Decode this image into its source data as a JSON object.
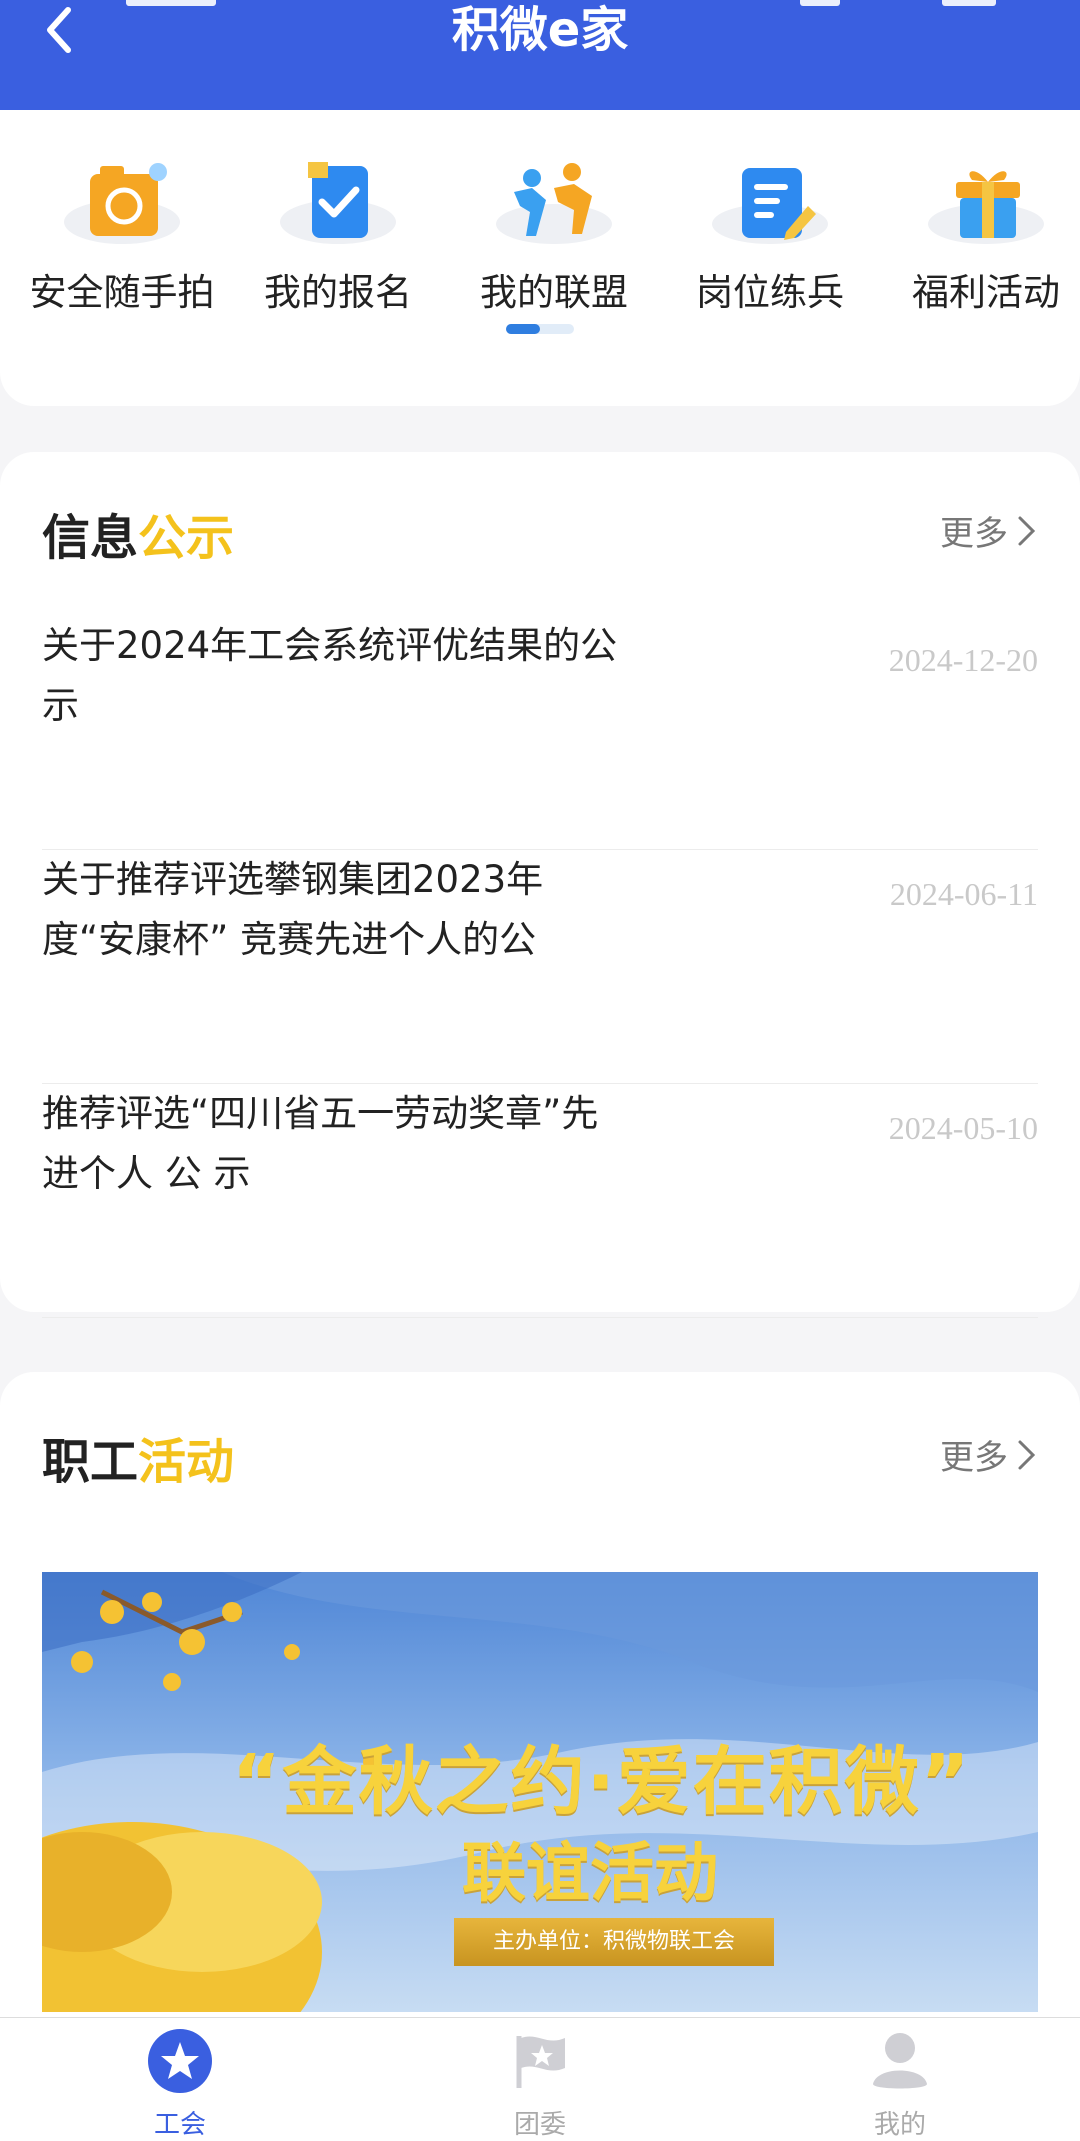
{
  "header": {
    "title": "积微e家"
  },
  "shortcuts": [
    {
      "label": "安全随手拍",
      "icon": "camera-icon",
      "color": "#f5a623"
    },
    {
      "label": "我的报名",
      "icon": "checkbox-icon",
      "color": "#2e8af0"
    },
    {
      "label": "我的联盟",
      "icon": "people-icon",
      "color": "#3aa0f0"
    },
    {
      "label": "岗位练兵",
      "icon": "document-icon",
      "color": "#2e8af0"
    },
    {
      "label": "福利活动",
      "icon": "gift-icon",
      "color": "#3aa0f0"
    }
  ],
  "info": {
    "title_a": "信息",
    "title_b": "公示",
    "more": "更多",
    "items": [
      {
        "text": "关于2024年工会系统评优结果的公示",
        "date": "2024-12-20"
      },
      {
        "text": "关于推荐评选攀钢集团2023年度“安康杯” 竞赛先进个人的公",
        "date": "2024-06-11"
      },
      {
        "text": "推荐评选“四川省五一劳动奖章”先进个人 公 示",
        "date": "2024-05-10"
      }
    ]
  },
  "activity": {
    "title_a": "职工",
    "title_b": "活动",
    "more": "更多",
    "banner": {
      "line1": "“金秋之约·爱在积微”",
      "line2": "联谊活动",
      "badge": "主办单位：积微物联工会"
    }
  },
  "nav": [
    {
      "label": "工会",
      "icon": "star-icon",
      "active": true
    },
    {
      "label": "团委",
      "icon": "flag-icon",
      "active": false
    },
    {
      "label": "我的",
      "icon": "user-icon",
      "active": false
    }
  ],
  "colors": {
    "primary": "#3a5fe0",
    "accent": "#f4c21c"
  }
}
